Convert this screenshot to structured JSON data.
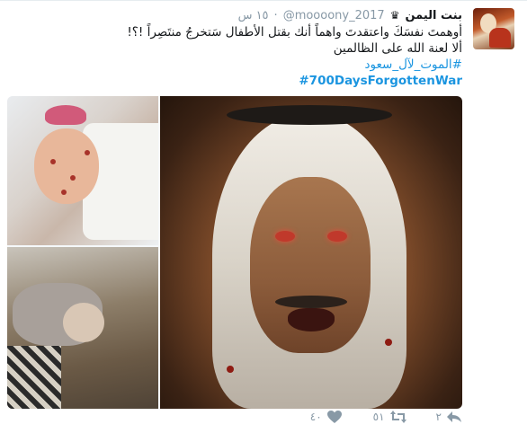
{
  "tweet": {
    "author_name": "بنت اليمن",
    "author_badge_icon": "crown-icon",
    "handle": "@moooony_2017",
    "separator": "·",
    "time": "١٥ س",
    "lines": [
      "أوهمتَ نفسَكَ واعتقدتَ واهماً أنك بقتل الأطفال سَتخرجُ منتَصِراً !؟!",
      "ألا لعنة الله على الظالمين"
    ],
    "hashtag_ar": "#الموت_لآل_سعود",
    "hashtag_en": "#700DaysForgottenWar",
    "colors": {
      "link": "#1b95e0",
      "meta": "#8899a6",
      "text": "#14171a"
    }
  },
  "actions": {
    "reply": {
      "icon": "reply-icon",
      "count": "٢"
    },
    "retweet": {
      "icon": "retweet-icon",
      "count": "٥١"
    },
    "like": {
      "icon": "heart-icon",
      "count": "٤٠"
    }
  }
}
